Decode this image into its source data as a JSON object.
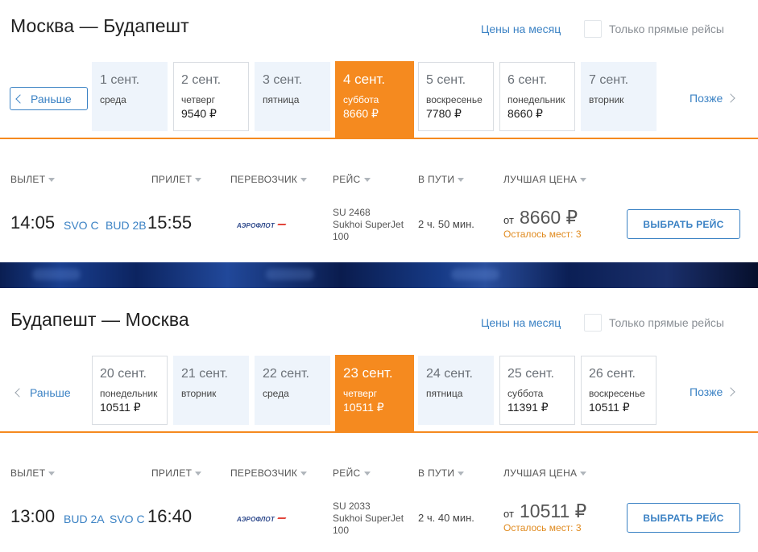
{
  "sections": [
    {
      "title": "Москва — Будапешт",
      "month_link": "Цены на месяц",
      "direct_label": "Только прямые рейсы",
      "earlier": "Раньше",
      "later": "Позже",
      "days": [
        {
          "date": "1 сент.",
          "dow": "среда",
          "price": ""
        },
        {
          "date": "2 сент.",
          "dow": "четверг",
          "price": "9540 ₽"
        },
        {
          "date": "3 сент.",
          "dow": "пятница",
          "price": ""
        },
        {
          "date": "4 сент.",
          "dow": "суббота",
          "price": "8660 ₽"
        },
        {
          "date": "5 сент.",
          "dow": "воскресенье",
          "price": "7780 ₽"
        },
        {
          "date": "6 сент.",
          "dow": "понедельник",
          "price": "8660 ₽"
        },
        {
          "date": "7 сент.",
          "dow": "вторник",
          "price": ""
        }
      ],
      "headers": {
        "depart": "ВЫЛЕТ",
        "arrive": "ПРИЛЕТ",
        "carrier": "ПЕРЕВОЗЧИК",
        "flight": "РЕЙС",
        "duration": "В ПУТИ",
        "best_price": "ЛУЧШАЯ ЦЕНА"
      },
      "flight": {
        "dep_time": "14:05",
        "dep_airport": "SVO C",
        "arr_airport": "BUD 2B",
        "arr_time": "15:55",
        "carrier_logo": "АЭРОФЛОТ",
        "number": "SU 2468",
        "aircraft_1": "Sukhoi SuperJet",
        "aircraft_2": "100",
        "duration": "2 ч. 50 мин.",
        "from": "от",
        "price": "8660 ₽",
        "seats": "Осталось мест: 3",
        "button": "ВЫБРАТЬ РЕЙС"
      }
    },
    {
      "title": "Будапешт — Москва",
      "month_link": "Цены на месяц",
      "direct_label": "Только прямые рейсы",
      "earlier": "Раньше",
      "later": "Позже",
      "days": [
        {
          "date": "20 сент.",
          "dow": "понедельник",
          "price": "10511 ₽"
        },
        {
          "date": "21 сент.",
          "dow": "вторник",
          "price": ""
        },
        {
          "date": "22 сент.",
          "dow": "среда",
          "price": ""
        },
        {
          "date": "23 сент.",
          "dow": "четверг",
          "price": "10511 ₽"
        },
        {
          "date": "24 сент.",
          "dow": "пятница",
          "price": ""
        },
        {
          "date": "25 сент.",
          "dow": "суббота",
          "price": "11391 ₽"
        },
        {
          "date": "26 сент.",
          "dow": "воскресенье",
          "price": "10511 ₽"
        }
      ],
      "headers": {
        "depart": "ВЫЛЕТ",
        "arrive": "ПРИЛЕТ",
        "carrier": "ПЕРЕВОЗЧИК",
        "flight": "РЕЙС",
        "duration": "В ПУТИ",
        "best_price": "ЛУЧШАЯ ЦЕНА"
      },
      "flight": {
        "dep_time": "13:00",
        "dep_airport": "BUD 2A",
        "arr_airport": "SVO C",
        "arr_time": "16:40",
        "carrier_logo": "АЭРОФЛОТ",
        "number": "SU 2033",
        "aircraft_1": "Sukhoi SuperJet",
        "aircraft_2": "100",
        "duration": "2 ч. 40 мин.",
        "from": "от",
        "price": "10511 ₽",
        "seats": "Осталось мест: 3",
        "button": "ВЫБРАТЬ РЕЙС"
      }
    }
  ],
  "colors": {
    "accent": "#f58a1f",
    "link": "#3b82c4",
    "day_bg": "#eef4fb",
    "seats": "#e08a1e"
  },
  "icons": {
    "prev": "chevron-left-icon",
    "next": "chevron-right-icon",
    "sort": "sort-down-icon",
    "logo": "aeroflot-logo"
  }
}
